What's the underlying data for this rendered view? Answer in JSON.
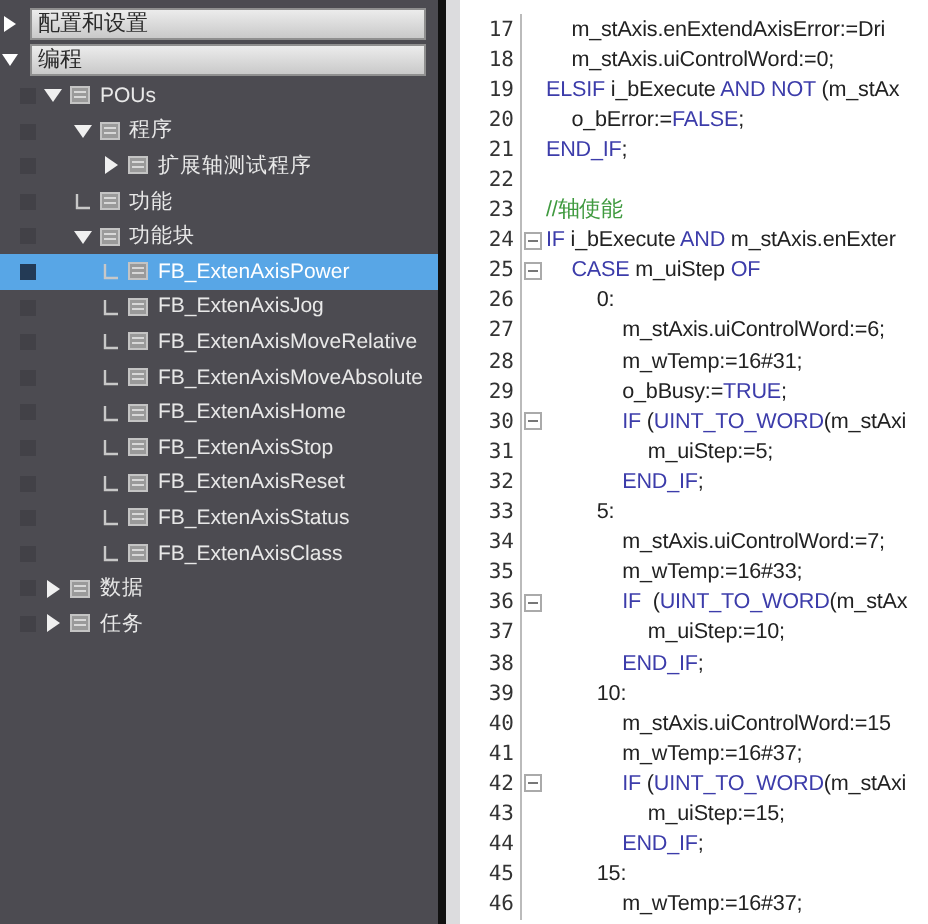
{
  "sections": [
    {
      "label": "配置和设置",
      "expanded": false
    },
    {
      "label": "编程",
      "expanded": true
    }
  ],
  "tree": [
    {
      "label": "POUs",
      "expanded": true,
      "selected": false,
      "children": [
        {
          "label": "程序",
          "expanded": true,
          "selected": false,
          "children": [
            {
              "label": "扩展轴测试程序",
              "expanded": false,
              "selected": false
            }
          ]
        },
        {
          "label": "功能",
          "selected": false
        },
        {
          "label": "功能块",
          "expanded": true,
          "selected": false,
          "children": [
            {
              "label": "FB_ExtenAxisPower",
              "selected": true
            },
            {
              "label": "FB_ExtenAxisJog",
              "selected": false
            },
            {
              "label": "FB_ExtenAxisMoveRelative",
              "selected": false
            },
            {
              "label": "FB_ExtenAxisMoveAbsolute",
              "selected": false
            },
            {
              "label": "FB_ExtenAxisHome",
              "selected": false
            },
            {
              "label": "FB_ExtenAxisStop",
              "selected": false
            },
            {
              "label": "FB_ExtenAxisReset",
              "selected": false
            },
            {
              "label": "FB_ExtenAxisStatus",
              "selected": false
            },
            {
              "label": "FB_ExtenAxisClass",
              "selected": false
            }
          ]
        }
      ]
    },
    {
      "label": "数据",
      "expanded": false,
      "selected": false
    },
    {
      "label": "任务",
      "expanded": false,
      "selected": false
    }
  ],
  "code": {
    "lines": [
      {
        "number": "17",
        "fold": false,
        "segments": [
          {
            "text": "\tm_stAxis.enExtendAxisError:=Dri",
            "kind": "plain"
          }
        ]
      },
      {
        "number": "18",
        "fold": false,
        "segments": [
          {
            "text": "\tm_stAxis.uiControlWord:=0;",
            "kind": "plain"
          }
        ]
      },
      {
        "number": "19",
        "fold": false,
        "segments": [
          {
            "text": "ELSIF",
            "kind": "kw"
          },
          {
            "text": " i_bExecute ",
            "kind": "plain"
          },
          {
            "text": "AND NOT",
            "kind": "kw"
          },
          {
            "text": " (m_stAx",
            "kind": "plain"
          }
        ]
      },
      {
        "number": "20",
        "fold": false,
        "segments": [
          {
            "text": "\to_bError:=",
            "kind": "plain"
          },
          {
            "text": "FALSE",
            "kind": "kw"
          },
          {
            "text": ";",
            "kind": "plain"
          }
        ]
      },
      {
        "number": "21",
        "fold": false,
        "segments": [
          {
            "text": "END_IF",
            "kind": "kw"
          },
          {
            "text": ";",
            "kind": "plain"
          }
        ]
      },
      {
        "number": "22",
        "fold": false
      },
      {
        "number": "23",
        "fold": false,
        "segments": [
          {
            "text": "//轴使能",
            "kind": "comment"
          }
        ]
      },
      {
        "number": "24",
        "fold": true,
        "segments": [
          {
            "text": "IF",
            "kind": "kw"
          },
          {
            "text": " i_bExecute ",
            "kind": "plain"
          },
          {
            "text": "AND",
            "kind": "kw"
          },
          {
            "text": " m_stAxis.enExter",
            "kind": "plain"
          }
        ]
      },
      {
        "number": "25",
        "fold": true,
        "segments": [
          {
            "text": "\tCASE",
            "kind": "kw"
          },
          {
            "text": " m_uiStep ",
            "kind": "plain"
          },
          {
            "text": "OF",
            "kind": "kw"
          }
        ]
      },
      {
        "number": "26",
        "fold": false,
        "segments": [
          {
            "text": "\t\t0:",
            "kind": "plain"
          }
        ]
      },
      {
        "number": "27",
        "fold": false,
        "segments": [
          {
            "text": "\t\t\tm_stAxis.uiControlWord:=6;",
            "kind": "plain"
          }
        ]
      },
      {
        "number": "28",
        "fold": false,
        "segments": [
          {
            "text": "\t\t\tm_wTemp:=16#31;",
            "kind": "plain"
          }
        ]
      },
      {
        "number": "29",
        "fold": false,
        "segments": [
          {
            "text": "\t\t\to_bBusy:=",
            "kind": "plain"
          },
          {
            "text": "TRUE",
            "kind": "kw"
          },
          {
            "text": ";",
            "kind": "plain"
          }
        ]
      },
      {
        "number": "30",
        "fold": true,
        "segments": [
          {
            "text": "\t\t\tIF",
            "kind": "kw"
          },
          {
            "text": " (",
            "kind": "plain"
          },
          {
            "text": "UINT_TO_WORD",
            "kind": "kw"
          },
          {
            "text": "(m_stAxi",
            "kind": "plain"
          }
        ]
      },
      {
        "number": "31",
        "fold": false,
        "segments": [
          {
            "text": "\t\t\t\tm_uiStep:=5;",
            "kind": "plain"
          }
        ]
      },
      {
        "number": "32",
        "fold": false,
        "segments": [
          {
            "text": "\t\t\tEND_IF",
            "kind": "kw"
          },
          {
            "text": ";",
            "kind": "plain"
          }
        ]
      },
      {
        "number": "33",
        "fold": false,
        "segments": [
          {
            "text": "\t\t5:",
            "kind": "plain"
          }
        ]
      },
      {
        "number": "34",
        "fold": false,
        "segments": [
          {
            "text": "\t\t\tm_stAxis.uiControlWord:=7;",
            "kind": "plain"
          }
        ]
      },
      {
        "number": "35",
        "fold": false,
        "segments": [
          {
            "text": "\t\t\tm_wTemp:=16#33;",
            "kind": "plain"
          }
        ]
      },
      {
        "number": "36",
        "fold": true,
        "segments": [
          {
            "text": "\t\t\tIF",
            "kind": "kw"
          },
          {
            "text": "  (",
            "kind": "plain"
          },
          {
            "text": "UINT_TO_WORD",
            "kind": "kw"
          },
          {
            "text": "(m_stAx",
            "kind": "plain"
          }
        ]
      },
      {
        "number": "37",
        "fold": false,
        "segments": [
          {
            "text": "\t\t\t\tm_uiStep:=10;",
            "kind": "plain"
          }
        ]
      },
      {
        "number": "38",
        "fold": false,
        "segments": [
          {
            "text": "\t\t\tEND_IF",
            "kind": "kw"
          },
          {
            "text": ";",
            "kind": "plain"
          }
        ]
      },
      {
        "number": "39",
        "fold": false,
        "segments": [
          {
            "text": "\t\t10:",
            "kind": "plain"
          }
        ]
      },
      {
        "number": "40",
        "fold": false,
        "segments": [
          {
            "text": "\t\t\tm_stAxis.uiControlWord:=15",
            "kind": "plain"
          }
        ]
      },
      {
        "number": "41",
        "fold": false,
        "segments": [
          {
            "text": "\t\t\tm_wTemp:=16#37;",
            "kind": "plain"
          }
        ]
      },
      {
        "number": "42",
        "fold": true,
        "segments": [
          {
            "text": "\t\t\tIF",
            "kind": "kw"
          },
          {
            "text": " (",
            "kind": "plain"
          },
          {
            "text": "UINT_TO_WORD",
            "kind": "kw"
          },
          {
            "text": "(m_stAxi",
            "kind": "plain"
          }
        ]
      },
      {
        "number": "43",
        "fold": false,
        "segments": [
          {
            "text": "\t\t\t\tm_uiStep:=15;",
            "kind": "plain"
          }
        ]
      },
      {
        "number": "44",
        "fold": false,
        "segments": [
          {
            "text": "\t\t\tEND_IF",
            "kind": "kw"
          },
          {
            "text": ";",
            "kind": "plain"
          }
        ]
      },
      {
        "number": "45",
        "fold": false,
        "segments": [
          {
            "text": "\t\t15:",
            "kind": "plain"
          }
        ]
      },
      {
        "number": "46",
        "fold": false,
        "segments": [
          {
            "text": "\t\t\tm_wTemp:=16#37;",
            "kind": "plain"
          }
        ]
      }
    ]
  }
}
